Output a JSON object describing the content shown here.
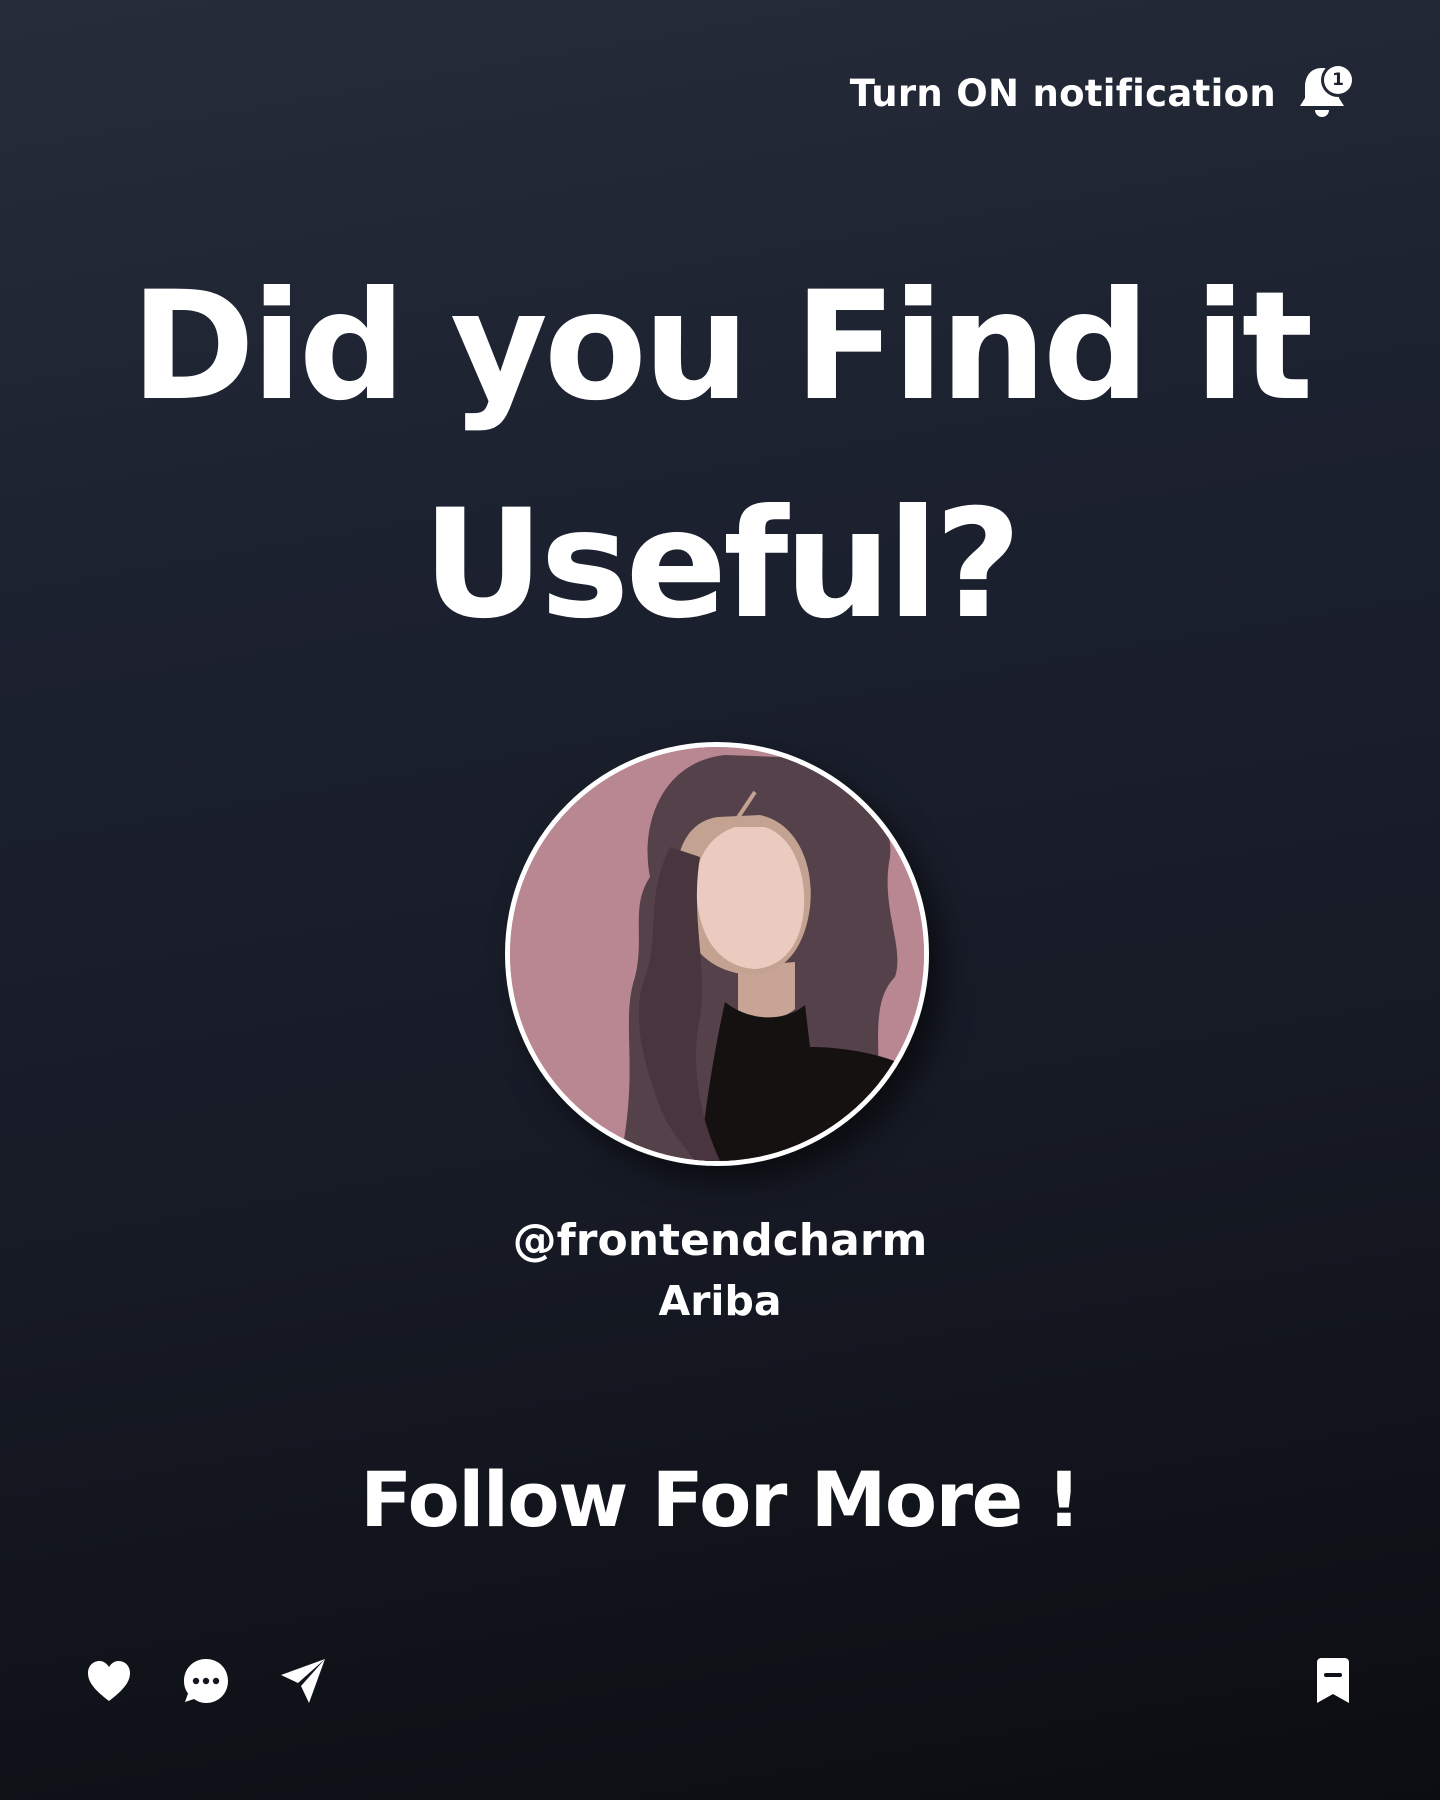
{
  "notification": {
    "label": "Turn ON notification",
    "badge_count": "1",
    "icon": "bell-icon"
  },
  "headline": {
    "line1": "Did you Find it",
    "line2": "Useful?"
  },
  "profile": {
    "handle": "@frontendcharm",
    "name": "Ariba",
    "avatar_icon": "woman-avatar-illustration"
  },
  "cta": {
    "text": "Follow For More !"
  },
  "actions": {
    "left": [
      "heart-icon",
      "comment-icon",
      "share-icon"
    ],
    "right": [
      "bookmark-icon"
    ]
  },
  "colors": {
    "background_top": "#262d3a",
    "background_bottom": "#0c0d12",
    "text": "#ffffff",
    "avatar_background": "#b98792"
  }
}
